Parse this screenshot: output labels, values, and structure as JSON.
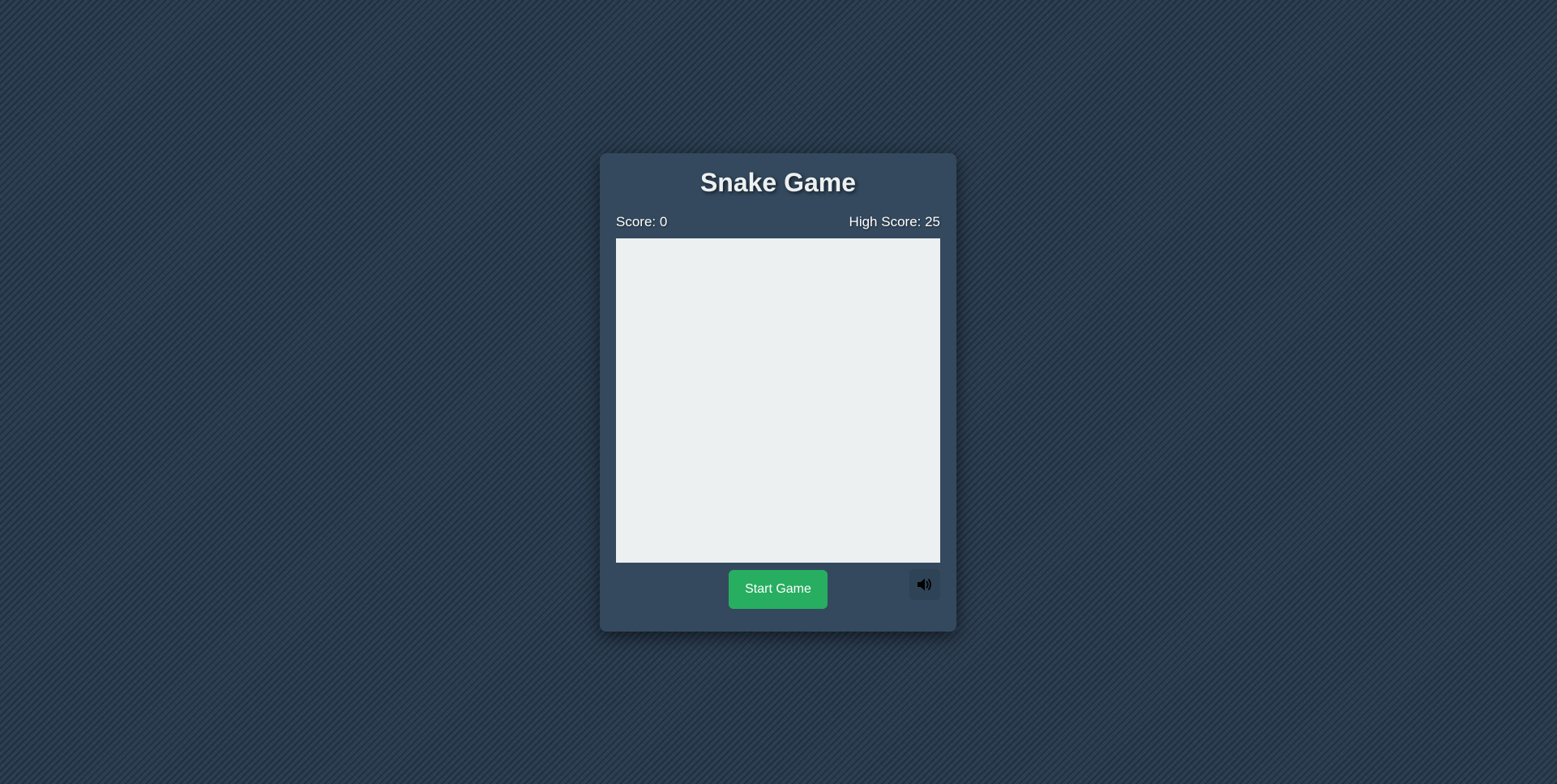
{
  "game": {
    "title": "Snake Game",
    "score_label": "Score: 0",
    "high_score_label": "High Score: 25",
    "start_button_label": "Start Game",
    "sound_icon": "speaker-volume-icon"
  },
  "colors": {
    "background": "#2c3e50",
    "panel": "#34495e",
    "board": "#ecf0f1",
    "start_button": "#27ae60",
    "text": "#ecf0f1"
  }
}
